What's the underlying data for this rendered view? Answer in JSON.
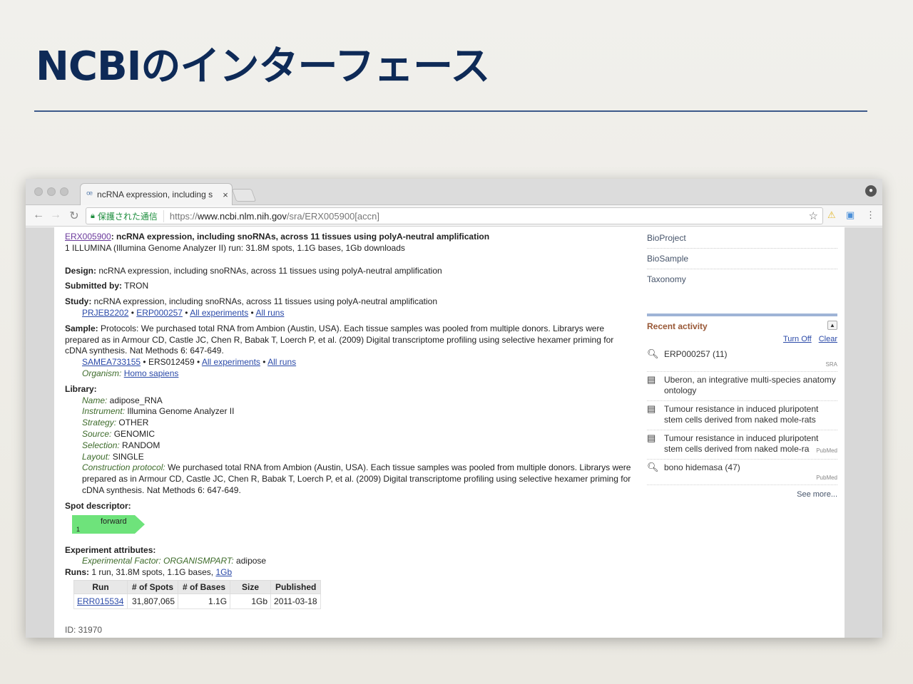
{
  "slide": {
    "title": "NCBIのインターフェース"
  },
  "browser": {
    "tab_title": "ncRNA expression, including s",
    "tab_close": "×",
    "secure_label": "保護された通信",
    "url_scheme": "https://",
    "url_host": "www.ncbi.nlm.nih.gov",
    "url_path": "/sra/ERX005900[accn]"
  },
  "record": {
    "accession": "ERX005900",
    "title": ": ncRNA expression, including snoRNAs, across 11 tissues using polyA-neutral amplification",
    "summary": "1 ILLUMINA (Illumina Genome Analyzer II) run: 31.8M spots, 1.1G bases, 1Gb downloads",
    "design_label": "Design:",
    "design": " ncRNA expression, including snoRNAs, across 11 tissues using polyA-neutral amplification",
    "submitted_label": "Submitted by:",
    "submitted": " TRON",
    "study_label": "Study:",
    "study": " ncRNA expression, including snoRNAs, across 11 tissues using polyA-neutral amplification",
    "study_links": {
      "prj": "PRJEB2202",
      "sep1": " • ",
      "erp": "ERP000257",
      "sep2": " • ",
      "all_exp": "All experiments",
      "sep3": " • ",
      "all_runs": "All runs"
    },
    "sample_label": "Sample:",
    "sample_line1": " Protocols: We purchased total RNA from Ambion (Austin, USA). Each tissue samples was pooled from multiple donors. Librarys were",
    "sample_line2": "prepared as in Armour CD, Castle JC, Chen R, Babak T, Loerch P, et al. (2009) Digital transcriptome profiling using selective hexamer priming for",
    "sample_line3": "cDNA synthesis. Nat Methods 6: 647-649.",
    "sample_links": {
      "sam": "SAMEA733155",
      "sep1": " • ",
      "ers": "ERS012459",
      "sep2": " • ",
      "all_exp": "All experiments",
      "sep3": " • ",
      "all_runs": "All runs"
    },
    "organism_label": "Organism:",
    "organism": "Homo sapiens",
    "library_label": "Library:",
    "library": [
      {
        "k": "Name:",
        "v": " adipose_RNA"
      },
      {
        "k": "Instrument:",
        "v": " Illumina Genome Analyzer II"
      },
      {
        "k": "Strategy:",
        "v": " OTHER"
      },
      {
        "k": "Source:",
        "v": " GENOMIC"
      },
      {
        "k": "Selection:",
        "v": " RANDOM"
      },
      {
        "k": "Layout:",
        "v": " SINGLE"
      }
    ],
    "construction_label": "Construction protocol:",
    "construction_line1": " We purchased total RNA from Ambion (Austin, USA). Each tissue samples was pooled from multiple donors. Librarys were",
    "construction_line2": "prepared as in Armour CD, Castle JC, Chen R, Babak T, Loerch P, et al. (2009) Digital transcriptome profiling using selective hexamer priming for",
    "construction_line3": "cDNA synthesis. Nat Methods 6: 647-649.",
    "spot_label": "Spot descriptor:",
    "spot_read": "forward",
    "spot_num": "1",
    "attrs_label": "Experiment attributes:",
    "attr_key": "Experimental Factor: ORGANISMPART:",
    "attr_val": " adipose",
    "runs_label": "Runs:",
    "runs_text": " 1 run, 31.8M spots, 1.1G bases, ",
    "runs_link": "1Gb",
    "runs_table": {
      "headers": [
        "Run",
        "# of Spots",
        "# of Bases",
        "Size",
        "Published"
      ],
      "row": [
        "ERR015534",
        "31,807,065",
        "1.1G",
        "1Gb",
        "2011-03-18"
      ]
    },
    "id_text": "ID: 31970"
  },
  "sidebar": {
    "links": [
      "BioProject",
      "BioSample",
      "Taxonomy"
    ],
    "recent_title": "Recent activity",
    "turn_off": "Turn Off",
    "clear": "Clear",
    "items": [
      {
        "text": "ERP000257 (11)",
        "source": "SRA",
        "icon": "search-icon"
      },
      {
        "text": "Uberon, an integrative multi-species anatomy ontology",
        "source": "",
        "icon": "document-icon"
      },
      {
        "text": "Tumour resistance in induced pluripotent stem cells derived from naked mole-rats",
        "source": "",
        "icon": "document-icon"
      },
      {
        "text": "Tumour resistance in induced pluripotent stem cells derived from naked mole-ra",
        "source": "PubMed",
        "icon": "document-icon"
      },
      {
        "text": "bono hidemasa (47)",
        "source": "PubMed",
        "icon": "search-icon"
      }
    ],
    "see_more": "See more..."
  }
}
